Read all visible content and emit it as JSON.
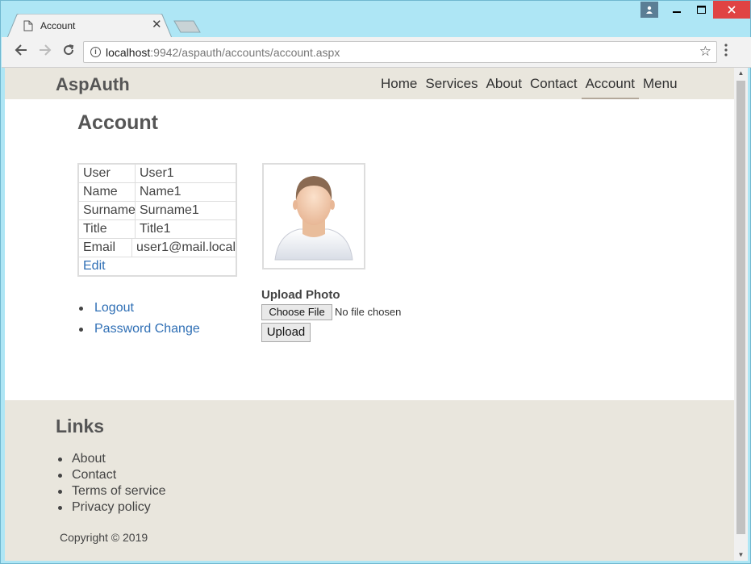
{
  "browser": {
    "tab_title": "Account",
    "url_host": "localhost",
    "url_rest": ":9942/aspauth/accounts/account.aspx"
  },
  "site": {
    "brand": "AspAuth",
    "nav": [
      {
        "label": "Home",
        "active": false
      },
      {
        "label": "Services",
        "active": false
      },
      {
        "label": "About",
        "active": false
      },
      {
        "label": "Contact",
        "active": false
      },
      {
        "label": "Account",
        "active": true
      },
      {
        "label": "Menu",
        "active": false
      }
    ]
  },
  "account": {
    "title": "Account",
    "rows": [
      {
        "key": "User",
        "value": "User1"
      },
      {
        "key": "Name",
        "value": "Name1"
      },
      {
        "key": "Surname",
        "value": "Surname1"
      },
      {
        "key": "Title",
        "value": "Title1"
      },
      {
        "key": "Email",
        "value": "user1@mail.local"
      }
    ],
    "edit_label": "Edit",
    "links": [
      "Logout",
      "Password Change"
    ],
    "upload": {
      "label": "Upload Photo",
      "choose_label": "Choose File",
      "file_status": "No file chosen",
      "upload_label": "Upload"
    }
  },
  "footer": {
    "title": "Links",
    "links": [
      "About",
      "Contact",
      "Terms of service",
      "Privacy policy"
    ],
    "copyright": "Copyright © 2019"
  },
  "colors": {
    "header_bg": "#e9e6dd",
    "link": "#2f6fb5",
    "window_frame": "#aee6f5",
    "close_button": "#e04343"
  }
}
